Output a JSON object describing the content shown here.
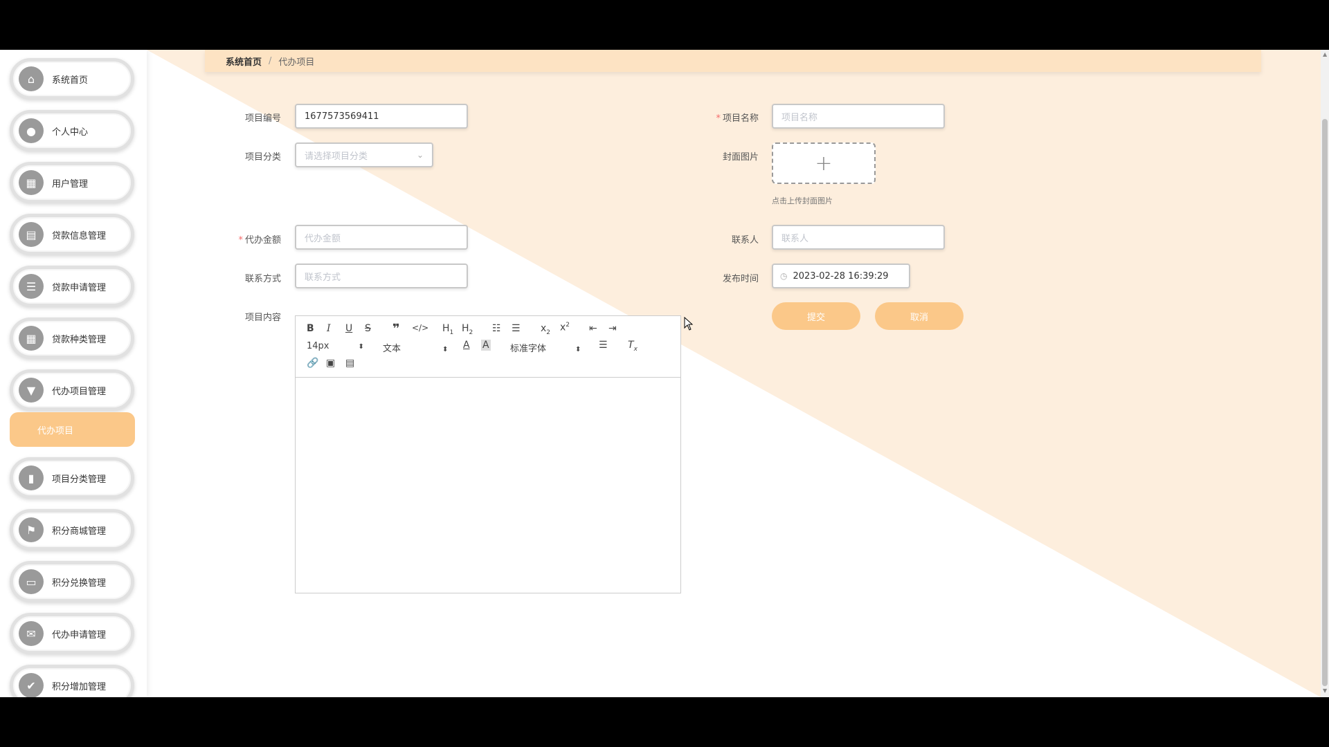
{
  "sidebar": {
    "items": [
      {
        "label": "系统首页",
        "icon": "home-icon"
      },
      {
        "label": "个人中心",
        "icon": "user-icon"
      },
      {
        "label": "用户管理",
        "icon": "grid-icon"
      },
      {
        "label": "贷款信息管理",
        "icon": "table-icon"
      },
      {
        "label": "贷款申请管理",
        "icon": "list-icon"
      },
      {
        "label": "贷款种类管理",
        "icon": "grid-icon"
      },
      {
        "label": "代办项目管理",
        "icon": "board-icon"
      },
      {
        "label": "项目分类管理",
        "icon": "bar-chart-icon"
      },
      {
        "label": "积分商城管理",
        "icon": "flag-icon"
      },
      {
        "label": "积分兑换管理",
        "icon": "monitor-icon"
      },
      {
        "label": "代办申请管理",
        "icon": "ticket-icon"
      },
      {
        "label": "积分增加管理",
        "icon": "thumb-up-icon"
      }
    ],
    "active_sub": "代办项目"
  },
  "breadcrumb": {
    "home": "系统首页",
    "sep": "/",
    "current": "代办项目"
  },
  "form": {
    "project_no": {
      "label": "项目编号",
      "value": "1677573569411"
    },
    "project_name": {
      "label": "项目名称",
      "placeholder": "项目名称"
    },
    "category": {
      "label": "项目分类",
      "placeholder": "请选择项目分类"
    },
    "cover": {
      "label": "封面图片",
      "tip": "点击上传封面图片"
    },
    "amount": {
      "label": "代办金额",
      "placeholder": "代办金额"
    },
    "contact": {
      "label": "联系人",
      "placeholder": "联系人"
    },
    "contact_method": {
      "label": "联系方式",
      "placeholder": "联系方式"
    },
    "publish_time": {
      "label": "发布时间",
      "value": "2023-02-28 16:39:29"
    },
    "content": {
      "label": "项目内容"
    }
  },
  "editor": {
    "font_size": "14px",
    "block_type": "文本",
    "font_family": "标准字体"
  },
  "buttons": {
    "submit": "提交",
    "cancel": "取消"
  },
  "colors": {
    "accent": "#fbc889",
    "breadcrumb_bg": "#fde3c3",
    "triangle": "#fdeedd"
  }
}
